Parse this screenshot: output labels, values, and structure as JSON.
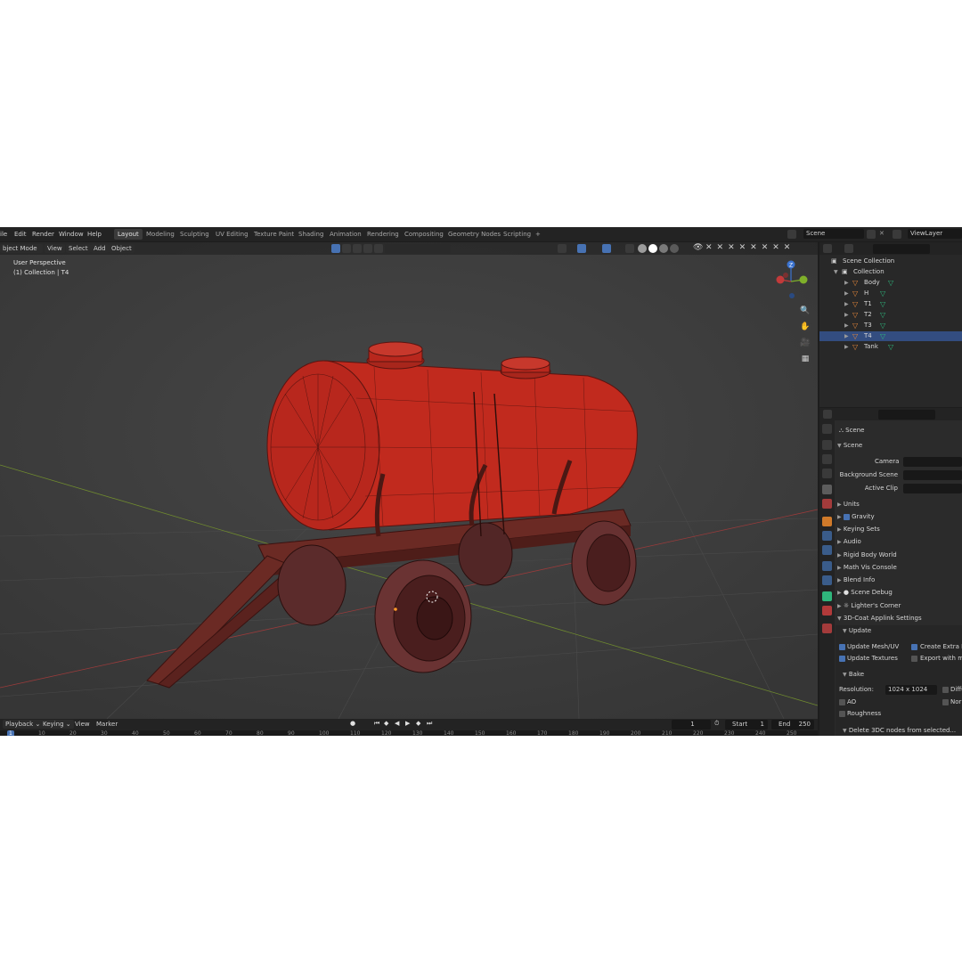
{
  "menus": [
    "ile",
    "Edit",
    "Render",
    "Window",
    "Help"
  ],
  "workspaces": [
    "Layout",
    "Modeling",
    "Sculpting",
    "UV Editing",
    "Texture Paint",
    "Shading",
    "Animation",
    "Rendering",
    "Compositing",
    "Geometry Nodes",
    "Scripting"
  ],
  "add_workspace": "+",
  "scene_field": "Scene",
  "viewlayer_field": "ViewLayer",
  "viewport": {
    "mode": "bject Mode",
    "header_menus": [
      "View",
      "Select",
      "Add",
      "Object"
    ],
    "overlay_title": "User Perspective",
    "overlay_subtitle": "(1) Collection | T4",
    "gizmo_z": "Z"
  },
  "outliner": {
    "root": "Scene Collection",
    "collection": "Collection",
    "objects": [
      "Body",
      "H",
      "T1",
      "T2",
      "T3",
      "T4",
      "Tank"
    ],
    "selected": "T4"
  },
  "properties": {
    "header": "Scene",
    "section_scene": "Scene",
    "camera_label": "Camera",
    "background_label": "Background Scene",
    "active_clip_label": "Active Clip",
    "panels": [
      "Units",
      "Gravity",
      "Keying Sets",
      "Audio",
      "Rigid Body World",
      "Math Vis Console",
      "Blend Info",
      "Scene Debug",
      "Lighter's Corner",
      "3D-Coat Applink Settings"
    ],
    "update_section": "Update",
    "update_mesh": "Update Mesh/UV",
    "create_extra": "Create Extra No",
    "update_textures": "Update Textures",
    "export_with": "Export with mo",
    "bake_section": "Bake",
    "resolution_label": "Resolution:",
    "resolution_value": "1024 x 1024",
    "diffuse": "Diffu",
    "ao": "AO",
    "normal": "Nor",
    "roughness": "Roughness",
    "delete_nodes": "Delete 3DC nodes from selected..."
  },
  "timeline": {
    "menus": [
      "Playback",
      "Keying",
      "View",
      "Marker"
    ],
    "current_frame": "1",
    "start_label": "Start",
    "start_value": "1",
    "end_label": "End",
    "end_value": "250",
    "ticks": [
      "1",
      "10",
      "20",
      "30",
      "40",
      "50",
      "60",
      "70",
      "80",
      "90",
      "100",
      "110",
      "120",
      "130",
      "140",
      "150",
      "160",
      "170",
      "180",
      "190",
      "200",
      "210",
      "220",
      "230",
      "240",
      "250"
    ]
  },
  "colors": {
    "tank_red": "#b8271d",
    "wire": "#5a1410",
    "select_blue": "#334d80",
    "active_tab": "#4772b3"
  }
}
